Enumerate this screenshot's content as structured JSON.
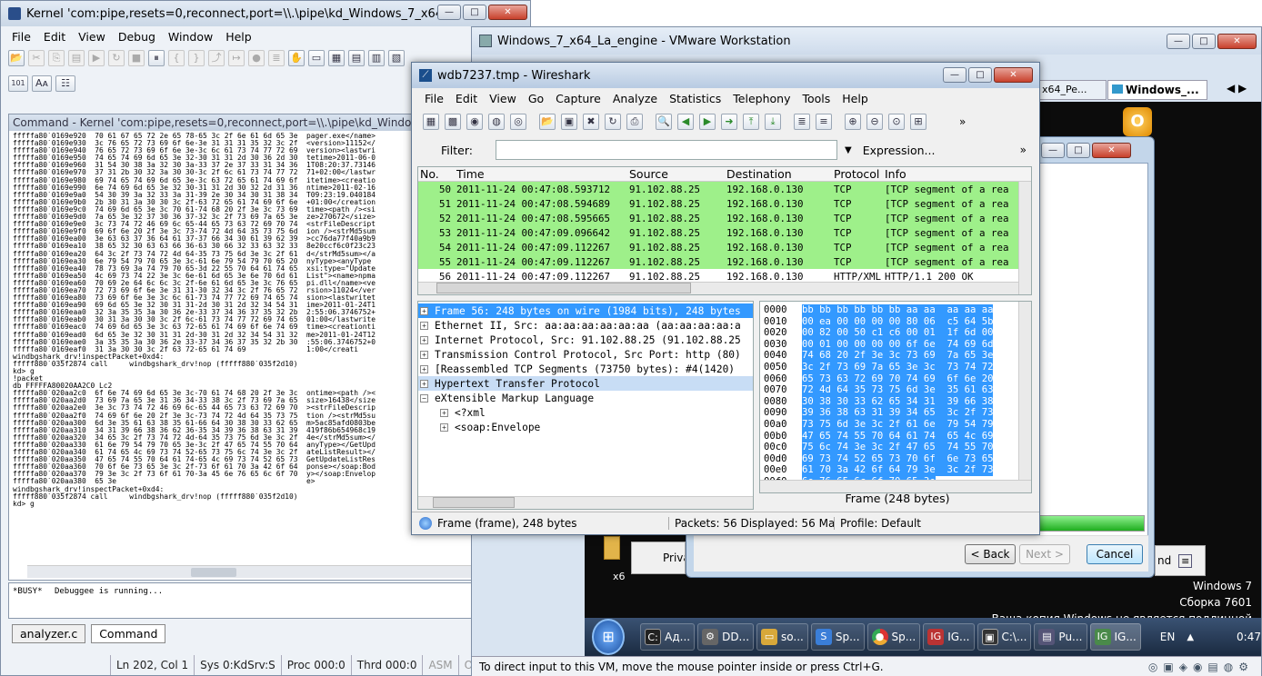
{
  "windbg": {
    "title": "Kernel 'com:pipe,resets=0,reconnect,port=\\\\.\\pipe\\kd_Windows_7_x64_La_engine' ...",
    "menu": [
      "File",
      "Edit",
      "View",
      "Debug",
      "Window",
      "Help"
    ],
    "command_title": "Command - Kernel 'com:pipe,resets=0,reconnect,port=\\\\.\\pipe\\kd_Windows_7_x64",
    "dump_rows": [
      "fffffa80`0169e920  70 61 67 65 72 2e 65 78-65 3c 2f 6e 61 6d 65 3e  pager.exe</name>",
      "fffffa80`0169e930  3c 76 65 72 73 69 6f 6e-3e 31 31 31 35 32 3c 2f  <version>11152</",
      "fffffa80`0169e940  76 65 72 73 69 6f 6e 3e-3c 6c 61 73 74 77 72 69  version><lastwri",
      "fffffa80`0169e950  74 65 74 69 6d 65 3e 32-30 31 31 2d 30 36 2d 30  tetime>2011-06-0",
      "fffffa80`0169e960  31 54 30 38 3a 32 30 3a-33 37 2e 37 33 31 34 36  1T08:20:37.73146",
      "fffffa80`0169e970  37 31 2b 30 32 3a 30 30-3c 2f 6c 61 73 74 77 72  71+02:00</lastwr",
      "fffffa80`0169e980  69 74 65 74 69 6d 65 3e-3c 63 72 65 61 74 69 6f  itetime><creatio",
      "fffffa80`0169e990  6e 74 69 6d 65 3e 32 30-31 31 2d 30 32 2d 31 36  ntime>2011-02-16",
      "fffffa80`0169e9a0  54 30 39 3a 32 33 3a 31-39 2e 30 34 30 31 38 34  T09:23:19.040184",
      "fffffa80`0169e9b0  2b 30 31 3a 30 30 3c 2f-63 72 65 61 74 69 6f 6e  +01:00</creation",
      "fffffa80`0169e9c0  74 69 6d 65 3e 3c 70 61-74 68 20 2f 3e 3c 73 69  time><path /><si",
      "fffffa80`0169e9d0  7a 65 3e 32 37 30 36 37-32 3c 2f 73 69 7a 65 3e  ze>270672</size>",
      "fffffa80`0169e9e0  3c 73 74 72 46 69 6c 65-44 65 73 63 72 69 70 74  <strFileDescript",
      "fffffa80`0169e9f0  69 6f 6e 20 2f 3e 3c 73-74 72 4d 64 35 73 75 6d  ion /><strMd5sum",
      "fffffa80`0169ea00  3e 63 63 37 36 64 61 37-37 66 34 30 61 39 62 39  >cc76da77f40a9b9",
      "fffffa80`0169ea10  38 65 32 30 63 63 66 36-63 30 66 32 33 63 32 33  8e20ccf6c0f23c23",
      "fffffa80`0169ea20  64 3c 2f 73 74 72 4d 64-35 73 75 6d 3e 3c 2f 61  d</strMd5sum></a",
      "fffffa80`0169ea30  6e 79 54 79 70 65 3e 3c-61 6e 79 54 79 70 65 20  nyType><anyType ",
      "fffffa80`0169ea40  78 73 69 3a 74 79 70 65-3d 22 55 70 64 61 74 65  xsi:type=\"Update",
      "fffffa80`0169ea50  4c 69 73 74 22 3e 3c 6e-61 6d 65 3e 6e 70 6d 61  List\"><name>npma",
      "fffffa80`0169ea60  70 69 2e 64 6c 6c 3c 2f-6e 61 6d 65 3e 3c 76 65  pi.dll</name><ve",
      "fffffa80`0169ea70  72 73 69 6f 6e 3e 31 31-30 32 34 3c 2f 76 65 72  rsion>11024</ver",
      "fffffa80`0169ea80  73 69 6f 6e 3e 3c 6c 61-73 74 77 72 69 74 65 74  sion><lastwritet",
      "fffffa80`0169ea90  69 6d 65 3e 32 30 31 31-2d 30 31 2d 32 34 54 31  ime>2011-01-24T1",
      "fffffa80`0169eaa0  32 3a 35 35 3a 30 36 2e-33 37 34 36 37 35 32 2b  2:55:06.3746752+",
      "fffffa80`0169eab0  30 31 3a 30 30 3c 2f 6c-61 73 74 77 72 69 74 65  01:00</lastwrite",
      "fffffa80`0169eac0  74 69 6d 65 3e 3c 63 72-65 61 74 69 6f 6e 74 69  time><creationti",
      "fffffa80`0169ead0  6d 65 3e 32 30 31 31 2d-30 31 2d 32 34 54 31 32  me>2011-01-24T12",
      "fffffa80`0169eae0  3a 35 35 3a 30 36 2e 33-37 34 36 37 35 32 2b 30  :55:06.3746752+0",
      "fffffa80`0169eaf0  31 3a 30 30 3c 2f 63 72-65 61 74 69              1:00</creati",
      "windbgshark_drv!inspectPacket+0xd4:",
      "fffff880`035f2874 call     windbgshark_drv!nop (fffff880`035f2d10)",
      "kd> g",
      "!packet",
      "db FFFFFA80020AA2C0 Lc2",
      "fffffa80`020aa2c0  6f 6e 74 69 6d 65 3e 3c-70 61 74 68 20 2f 3e 3c  ontime><path /><",
      "fffffa80`020aa2d0  73 69 7a 65 3e 31 36 34-33 38 3c 2f 73 69 7a 65  size>16438</size",
      "fffffa80`020aa2e0  3e 3c 73 74 72 46 69 6c-65 44 65 73 63 72 69 70  ><strFileDescrip",
      "fffffa80`020aa2f0  74 69 6f 6e 20 2f 3e 3c-73 74 72 4d 64 35 73 75  tion /><strMd5su",
      "fffffa80`020aa300  6d 3e 35 61 63 38 35 61-66 64 30 38 30 33 62 65  m>5ac85afd0803be",
      "fffffa80`020aa310  34 31 39 66 38 36 62 36-35 34 39 36 38 63 31 39  419f86b654968c19",
      "fffffa80`020aa320  34 65 3c 2f 73 74 72 4d-64 35 73 75 6d 3e 3c 2f  4e</strMd5sum></",
      "fffffa80`020aa330  61 6e 79 54 79 70 65 3e-3c 2f 47 65 74 55 70 64  anyType></GetUpd",
      "fffffa80`020aa340  61 74 65 4c 69 73 74 52-65 73 75 6c 74 3e 3c 2f  ateListResult></",
      "fffffa80`020aa350  47 65 74 55 70 64 61 74-65 4c 69 73 74 52 65 73  GetUpdateListRes",
      "fffffa80`020aa360  70 6f 6e 73 65 3e 3c 2f-73 6f 61 70 3a 42 6f 64  ponse></soap:Bod",
      "fffffa80`020aa370  79 3e 3c 2f 73 6f 61 70-3a 45 6e 76 65 6c 6f 70  y></soap:Envelop",
      "fffffa80`020aa380  65 3e                                            e>",
      "windbgshark_drv!inspectPacket+0xd4:",
      "fffff880`035f2874 call     windbgshark_drv!nop (fffff880`035f2d10)",
      "kd> g"
    ],
    "busy_label": "*BUSY*",
    "busy_text": "Debuggee is running...",
    "tabs": [
      "analyzer.c",
      "Command"
    ],
    "status": [
      "Ln 202, Col 1",
      "Sys 0:KdSrv:S",
      "Proc 000:0",
      "Thrd 000:0",
      "ASM",
      "OVR",
      "CA"
    ]
  },
  "vmware": {
    "title": "Windows_7_x64_La_engine - VMware Workstation",
    "tabs": [
      "x64_Pe...",
      "Windows_..."
    ],
    "status": "To direct input to this VM, move the mouse pointer inside or press Ctrl+G.",
    "watermark": [
      "Windows 7",
      "Сборка 7601",
      "Ваша копия Windows не является подлинной"
    ],
    "taskbar": [
      "Ад...",
      "DD...",
      "so...",
      "Sp...",
      "Sp...",
      "IG...",
      "C:\\...",
      "Pu...",
      "IG..."
    ],
    "lang": "EN",
    "clock": "0:47"
  },
  "wizard": {
    "buttons": [
      "< Back",
      "Next >",
      "Cancel"
    ],
    "side_labels": [
      "Priva",
      "x6",
      "nd"
    ]
  },
  "wireshark": {
    "title": "wdb7237.tmp - Wireshark",
    "menu": [
      "File",
      "Edit",
      "View",
      "Go",
      "Capture",
      "Analyze",
      "Statistics",
      "Telephony",
      "Tools",
      "Help"
    ],
    "filter_label": "Filter:",
    "expression_label": "Expression...",
    "columns": [
      "No.",
      "Time",
      "Source",
      "Destination",
      "Protocol",
      "Info"
    ],
    "packets": [
      [
        "50",
        "2011-11-24 00:47:08.593712",
        "91.102.88.25",
        "192.168.0.130",
        "TCP",
        "[TCP segment of a rea"
      ],
      [
        "51",
        "2011-11-24 00:47:08.594689",
        "91.102.88.25",
        "192.168.0.130",
        "TCP",
        "[TCP segment of a rea"
      ],
      [
        "52",
        "2011-11-24 00:47:08.595665",
        "91.102.88.25",
        "192.168.0.130",
        "TCP",
        "[TCP segment of a rea"
      ],
      [
        "53",
        "2011-11-24 00:47:09.096642",
        "91.102.88.25",
        "192.168.0.130",
        "TCP",
        "[TCP segment of a rea"
      ],
      [
        "54",
        "2011-11-24 00:47:09.112267",
        "91.102.88.25",
        "192.168.0.130",
        "TCP",
        "[TCP segment of a rea"
      ],
      [
        "55",
        "2011-11-24 00:47:09.112267",
        "91.102.88.25",
        "192.168.0.130",
        "TCP",
        "[TCP segment of a rea"
      ],
      [
        "56",
        "2011-11-24 00:47:09.112267",
        "91.102.88.25",
        "192.168.0.130",
        "HTTP/XML",
        "HTTP/1.1 200 OK"
      ]
    ],
    "tree": [
      "Frame 56: 248 bytes on wire (1984 bits), 248 bytes",
      "Ethernet II, Src: aa:aa:aa:aa:aa:aa (aa:aa:aa:aa:a",
      "Internet Protocol, Src: 91.102.88.25 (91.102.88.25",
      "Transmission Control Protocol, Src Port: http (80)",
      "[Reassembled TCP Segments (73750 bytes): #4(1420)",
      "Hypertext Transfer Protocol",
      "eXtensible Markup Language",
      "<?xml",
      "<soap:Envelope"
    ],
    "hex_offsets": [
      "0000",
      "0010",
      "0020",
      "0030",
      "0040",
      "0050",
      "0060",
      "0070",
      "0080",
      "0090",
      "00a0",
      "00b0",
      "00c0",
      "00d0",
      "00e0",
      "00f0"
    ],
    "hex_bytes": [
      "bb bb bb bb bb bb aa aa  aa aa aa",
      "00 ea 00 00 00 00 80 06  c5 64 5b",
      "00 82 00 50 c1 c6 00 01  1f 6d 00",
      "00 01 00 00 00 00 6f 6e  74 69 6d",
      "74 68 20 2f 3e 3c 73 69  7a 65 3e",
      "3c 2f 73 69 7a 65 3e 3c  73 74 72",
      "65 73 63 72 69 70 74 69  6f 6e 20",
      "72 4d 64 35 73 75 6d 3e  35 61 63",
      "30 38 30 33 62 65 34 31  39 66 38",
      "39 36 38 63 31 39 34 65  3c 2f 73",
      "73 75 6d 3e 3c 2f 61 6e  79 54 79",
      "47 65 74 55 70 64 61 74  65 4c 69",
      "75 6c 74 3e 3c 2f 47 65  74 55 70",
      "69 73 74 52 65 73 70 6f  6e 73 65",
      "61 70 3a 42 6f 64 79 3e  3c 2f 73",
      "6e 76 65 6c 6f 70 65 3e"
    ],
    "bytes_tab": "Frame (248 bytes)",
    "status": [
      "Frame (frame), 248 bytes",
      "Packets: 56 Displayed: 56 Mark...",
      "Profile: Default"
    ]
  }
}
